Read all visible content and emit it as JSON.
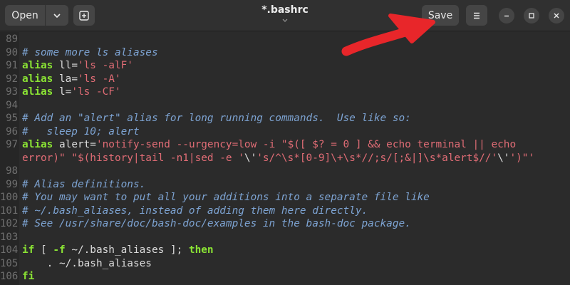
{
  "header": {
    "open_label": "Open",
    "save_label": "Save",
    "title": "*.bashrc"
  },
  "icons": {
    "open_menu": "chevron-down-icon",
    "new_tab": "new-tab-icon",
    "menu": "hamburger-icon",
    "minimize": "minimize-icon",
    "maximize": "maximize-icon",
    "close": "close-icon",
    "annotation": "red-arrow"
  },
  "colors": {
    "comment": "#7da3d2",
    "keyword": "#8ae234",
    "string": "#e06c75",
    "arrow": "#e8262a"
  },
  "editor": {
    "lines": [
      {
        "n": "89",
        "segs": []
      },
      {
        "n": "90",
        "segs": [
          {
            "t": "# some more ls aliases",
            "c": "comment"
          }
        ]
      },
      {
        "n": "91",
        "segs": [
          {
            "t": "alias",
            "c": "kw"
          },
          {
            "t": " ll=",
            "c": ""
          },
          {
            "t": "'ls -alF'",
            "c": "str"
          }
        ]
      },
      {
        "n": "92",
        "segs": [
          {
            "t": "alias",
            "c": "kw"
          },
          {
            "t": " la=",
            "c": ""
          },
          {
            "t": "'ls -A'",
            "c": "str"
          }
        ]
      },
      {
        "n": "93",
        "segs": [
          {
            "t": "alias",
            "c": "kw"
          },
          {
            "t": " l=",
            "c": ""
          },
          {
            "t": "'ls -CF'",
            "c": "str"
          }
        ]
      },
      {
        "n": "94",
        "segs": []
      },
      {
        "n": "95",
        "segs": [
          {
            "t": "# Add an \"alert\" alias for long running commands.  Use like so:",
            "c": "comment"
          }
        ]
      },
      {
        "n": "96",
        "segs": [
          {
            "t": "#   sleep 10; alert",
            "c": "comment"
          }
        ]
      },
      {
        "n": "97",
        "segs": [
          {
            "t": "alias",
            "c": "kw"
          },
          {
            "t": " alert=",
            "c": ""
          },
          {
            "t": "'notify-send --urgency=low -i \"$([ $? = 0 ] && echo terminal || echo",
            "c": "str"
          }
        ]
      },
      {
        "n": "",
        "segs": [
          {
            "t": "error)\" \"$(history|tail -n1|sed -e '",
            "c": "str"
          },
          {
            "t": "\\'",
            "c": ""
          },
          {
            "t": "'s/^\\s*[0-9]\\+\\s*//;s/[;&|]\\s*alert$//'",
            "c": "str"
          },
          {
            "t": "\\'",
            "c": ""
          },
          {
            "t": "')\"'",
            "c": "str"
          }
        ]
      },
      {
        "n": "98",
        "segs": []
      },
      {
        "n": "99",
        "segs": [
          {
            "t": "# Alias definitions.",
            "c": "comment"
          }
        ]
      },
      {
        "n": "100",
        "segs": [
          {
            "t": "# You may want to put all your additions into a separate file like",
            "c": "comment"
          }
        ]
      },
      {
        "n": "101",
        "segs": [
          {
            "t": "# ~/.bash_aliases, instead of adding them here directly.",
            "c": "comment"
          }
        ]
      },
      {
        "n": "102",
        "segs": [
          {
            "t": "# See /usr/share/doc/bash-doc/examples in the bash-doc package.",
            "c": "comment"
          }
        ]
      },
      {
        "n": "103",
        "segs": []
      },
      {
        "n": "104",
        "segs": [
          {
            "t": "if",
            "c": "kw"
          },
          {
            "t": " [ ",
            "c": ""
          },
          {
            "t": "-f",
            "c": "kw"
          },
          {
            "t": " ~/.bash_aliases ]; ",
            "c": ""
          },
          {
            "t": "then",
            "c": "kw"
          }
        ]
      },
      {
        "n": "105",
        "segs": [
          {
            "t": "    . ~/.bash_aliases",
            "c": ""
          }
        ]
      },
      {
        "n": "106",
        "segs": [
          {
            "t": "fi",
            "c": "kw"
          }
        ]
      }
    ]
  }
}
